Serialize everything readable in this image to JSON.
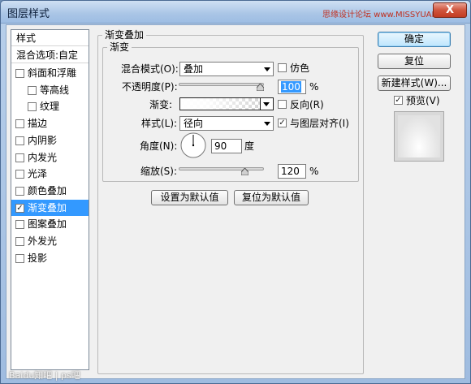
{
  "window": {
    "title": "图层样式",
    "close_label": "X",
    "watermark_top": "思缘设计论坛 www.MISSYUAN.COM",
    "watermark_bottom": "Baidu知吧 | ps吧"
  },
  "style_list": {
    "header": "样式",
    "blend_options": "混合选项:自定",
    "items": [
      {
        "label": "斜面和浮雕",
        "checked": false,
        "indent": false,
        "selected": false
      },
      {
        "label": "等高线",
        "checked": false,
        "indent": true,
        "selected": false
      },
      {
        "label": "纹理",
        "checked": false,
        "indent": true,
        "selected": false
      },
      {
        "label": "描边",
        "checked": false,
        "indent": false,
        "selected": false
      },
      {
        "label": "内阴影",
        "checked": false,
        "indent": false,
        "selected": false
      },
      {
        "label": "内发光",
        "checked": false,
        "indent": false,
        "selected": false
      },
      {
        "label": "光泽",
        "checked": false,
        "indent": false,
        "selected": false
      },
      {
        "label": "颜色叠加",
        "checked": false,
        "indent": false,
        "selected": false
      },
      {
        "label": "渐变叠加",
        "checked": true,
        "indent": false,
        "selected": true
      },
      {
        "label": "图案叠加",
        "checked": false,
        "indent": false,
        "selected": false
      },
      {
        "label": "外发光",
        "checked": false,
        "indent": false,
        "selected": false
      },
      {
        "label": "投影",
        "checked": false,
        "indent": false,
        "selected": false
      }
    ]
  },
  "panel": {
    "outer_title": "渐变叠加",
    "inner_title": "渐变",
    "blend_mode_label": "混合模式(O):",
    "blend_mode_value": "叠加",
    "dither_label": "仿色",
    "dither_checked": false,
    "opacity_label": "不透明度(P):",
    "opacity_value": "100",
    "opacity_unit": "%",
    "opacity_percent": 100,
    "gradient_label": "渐变:",
    "reverse_label": "反向(R)",
    "reverse_checked": false,
    "style_label": "样式(L):",
    "style_value": "径向",
    "align_label": "与图层对齐(I)",
    "align_checked": true,
    "angle_label": "角度(N):",
    "angle_value": "90",
    "angle_unit": "度",
    "angle_degrees": 90,
    "scale_label": "缩放(S):",
    "scale_value": "120",
    "scale_unit": "%",
    "scale_percent": 120,
    "scale_max": 150,
    "set_default_label": "设置为默认值",
    "reset_default_label": "复位为默认值"
  },
  "buttons": {
    "ok": "确定",
    "reset": "复位",
    "new_style": "新建样式(W)...",
    "preview_label": "预览(V)",
    "preview_checked": true
  },
  "check_mark": "✓",
  "colors": {
    "selection": "#3399ff",
    "title_bar": "#a9c5e6",
    "close_button": "#c23b22"
  }
}
